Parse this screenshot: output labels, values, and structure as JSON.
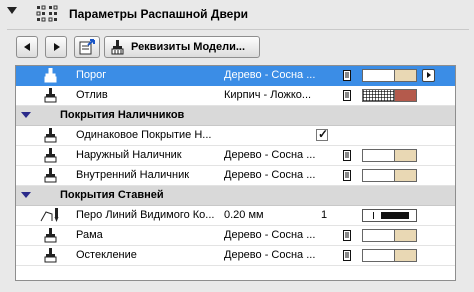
{
  "header": {
    "title": "Параметры Распашной Двери"
  },
  "toolbar": {
    "model_button_label": "Реквизиты Модели..."
  },
  "colors": {
    "selection": "#3b8de6",
    "wood_swatch": "#e9d8b4",
    "brick_swatch": "#b45a4c",
    "group_bg": "#d9d9d9"
  },
  "rows": [
    {
      "type": "item",
      "name": "Порог",
      "value": "Дерево - Сосна ...",
      "selected": true,
      "swatch": "wood"
    },
    {
      "type": "item",
      "name": "Отлив",
      "value": "Кирпич - Ложко...",
      "selected": false,
      "swatch": "brick"
    },
    {
      "type": "group",
      "name": "Покрытия Наличников"
    },
    {
      "type": "item",
      "name": "Одинаковое Покрытие Н...",
      "checkbox": true
    },
    {
      "type": "item",
      "name": "Наружный Наличник",
      "value": "Дерево - Сосна ...",
      "swatch": "wood"
    },
    {
      "type": "item",
      "name": "Внутренний Наличник",
      "value": "Дерево - Сосна ...",
      "swatch": "wood"
    },
    {
      "type": "group",
      "name": "Покрытия Ставней"
    },
    {
      "type": "pen",
      "name": "Перо Линий Видимого Ко...",
      "value": "0.20 мм",
      "num": "1"
    },
    {
      "type": "item",
      "name": "Рама",
      "value": "Дерево - Сосна ...",
      "swatch": "wood"
    },
    {
      "type": "item",
      "name": "Остекление",
      "value": "Дерево - Сосна ...",
      "swatch": "wood"
    }
  ]
}
